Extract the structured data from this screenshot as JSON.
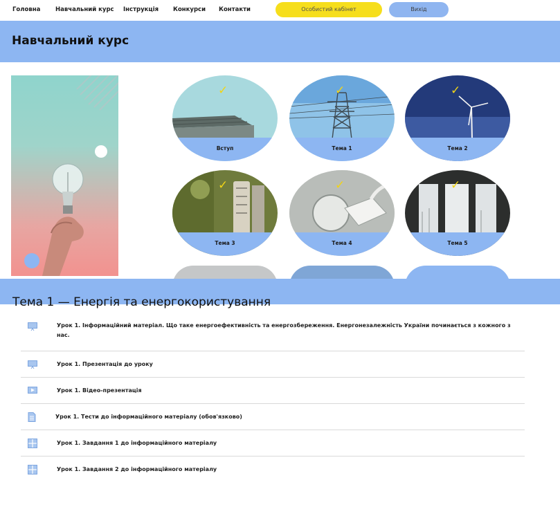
{
  "nav": {
    "links": [
      "Головна",
      "Навчальний курс",
      "Інструкція",
      "Конкурси",
      "Контакти"
    ],
    "cabinet_label": "Особистий кабінет",
    "exit_label": "Вихід"
  },
  "course": {
    "title": "Навчальний курс",
    "topics": [
      {
        "label": "Вступ",
        "completed": true
      },
      {
        "label": "Тема 1",
        "completed": true
      },
      {
        "label": "Тема 2",
        "completed": true
      },
      {
        "label": "Тема 3",
        "completed": true
      },
      {
        "label": "Тема 4",
        "completed": true
      },
      {
        "label": "Тема 5",
        "completed": true
      }
    ]
  },
  "topic_section": {
    "title": "Тема 1 — Енергія та енергокористування",
    "lessons": [
      {
        "icon": "presentation-icon",
        "text": "Урок 1. Інформаційний матеріал. Що таке енергоефективність та енергозбереження. Енергонезалежність України починається з кожного з нас."
      },
      {
        "icon": "presentation-icon",
        "text": "Урок 1. Презентація до уроку"
      },
      {
        "icon": "video-icon",
        "text": "Урок 1. Відео-презентація"
      },
      {
        "icon": "document-icon",
        "text": "Урок 1. Тести до інформаційного матеріалу (обов'язково)"
      },
      {
        "icon": "task-grid-icon",
        "text": "Урок 1. Завдання 1 до інформаційного матеріалу"
      },
      {
        "icon": "task-grid-icon",
        "text": "Урок 1. Завдання 2 до інформаційного матеріалу"
      }
    ]
  },
  "colors": {
    "band": "#8db6f2",
    "cabinet_button": "#f6de1c",
    "exit_button": "#8fb5f0",
    "checkmark": "#f1d416"
  }
}
